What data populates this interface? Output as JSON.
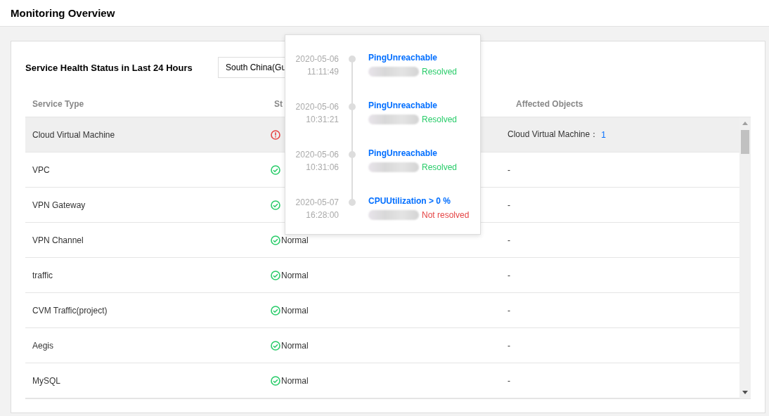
{
  "page": {
    "title": "Monitoring Overview"
  },
  "section": {
    "title": "Service Health Status in Last 24 Hours",
    "region_select": {
      "value": "South China(Gu"
    }
  },
  "table": {
    "columns": [
      "Service Type",
      "St",
      "Affected Objects"
    ],
    "rows": [
      {
        "service": "Cloud Virtual Machine",
        "status": {
          "kind": "abnormal"
        },
        "affected": {
          "text": "Cloud Virtual Machine：",
          "count": "1"
        },
        "selected": true
      },
      {
        "service": "VPC",
        "status": {
          "kind": "normal"
        },
        "affected": {
          "text": "-"
        },
        "selected": false
      },
      {
        "service": "VPN Gateway",
        "status": {
          "kind": "normal"
        },
        "affected": {
          "text": "-"
        },
        "selected": false
      },
      {
        "service": "VPN Channel",
        "status": {
          "kind": "normal",
          "text": "Normal"
        },
        "affected": {
          "text": "-"
        },
        "selected": false
      },
      {
        "service": "traffic",
        "status": {
          "kind": "normal",
          "text": "Normal"
        },
        "affected": {
          "text": "-"
        },
        "selected": false
      },
      {
        "service": "CVM Traffic(project)",
        "status": {
          "kind": "normal",
          "text": "Normal"
        },
        "affected": {
          "text": "-"
        },
        "selected": false
      },
      {
        "service": "Aegis",
        "status": {
          "kind": "normal",
          "text": "Normal"
        },
        "affected": {
          "text": "-"
        },
        "selected": false
      },
      {
        "service": "MySQL",
        "status": {
          "kind": "normal",
          "text": "Normal"
        },
        "affected": {
          "text": "-"
        },
        "selected": false
      }
    ]
  },
  "event_popover": {
    "events": [
      {
        "date": "2020-05-06",
        "time": "11:11:49",
        "title": "PingUnreachable",
        "status": "Resolved",
        "resolved": true
      },
      {
        "date": "2020-05-06",
        "time": "10:31:21",
        "title": "PingUnreachable",
        "status": "Resolved",
        "resolved": true
      },
      {
        "date": "2020-05-06",
        "time": "10:31:06",
        "title": "PingUnreachable",
        "status": "Resolved",
        "resolved": true
      },
      {
        "date": "2020-05-07",
        "time": "16:28:00",
        "title": "CPUUtilization > 0 %",
        "status": "Not resolved",
        "resolved": false
      }
    ]
  }
}
